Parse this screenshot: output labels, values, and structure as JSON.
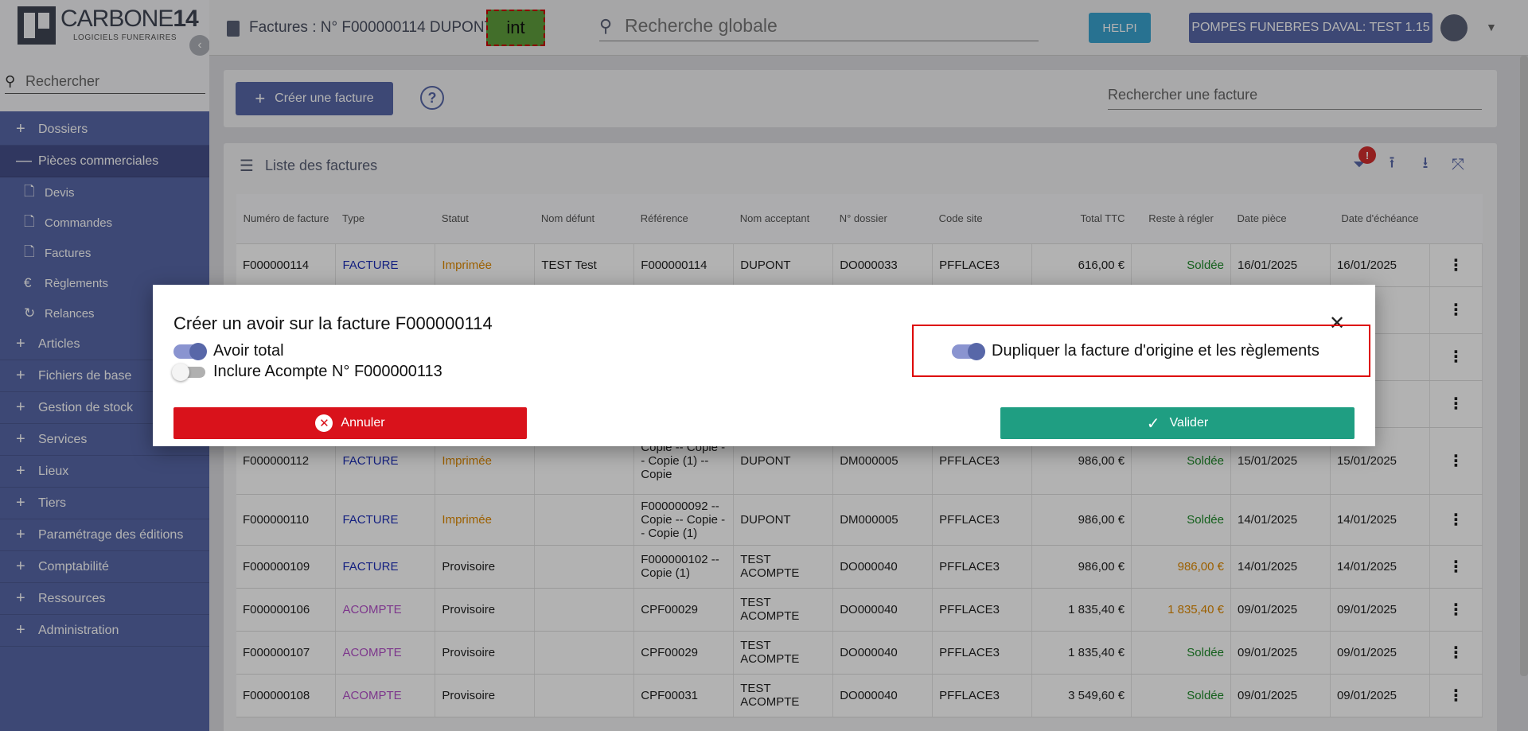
{
  "brand": {
    "name_light": "CARBONE",
    "name_bold": "14",
    "tagline": "LOGICIELS FUNERAIRES"
  },
  "sidebar": {
    "search_placeholder": "Rechercher",
    "items": [
      {
        "label": "Dossiers",
        "expander": "+"
      },
      {
        "label": "Pièces commerciales",
        "expander": "—"
      },
      {
        "label": "Articles",
        "expander": "+"
      },
      {
        "label": "Fichiers de base",
        "expander": "+"
      },
      {
        "label": "Gestion de stock",
        "expander": "+"
      },
      {
        "label": "Services",
        "expander": "+"
      },
      {
        "label": "Lieux",
        "expander": "+"
      },
      {
        "label": "Tiers",
        "expander": "+"
      },
      {
        "label": "Paramétrage des éditions",
        "expander": "+"
      },
      {
        "label": "Comptabilité",
        "expander": "+"
      },
      {
        "label": "Ressources",
        "expander": "+"
      },
      {
        "label": "Administration",
        "expander": "+"
      }
    ],
    "subitems": [
      {
        "label": "Devis",
        "icon": "document-plus-icon"
      },
      {
        "label": "Commandes",
        "icon": "document-upload-icon"
      },
      {
        "label": "Factures",
        "icon": "invoice-icon"
      },
      {
        "label": "Règlements",
        "icon": "euro-icon"
      },
      {
        "label": "Relances",
        "icon": "reminder-icon"
      }
    ]
  },
  "topbar": {
    "title": "Factures : N° F000000114 DUPONT",
    "env_badge": "int",
    "global_search_placeholder": "Recherche globale",
    "helpi_label": "HELPI",
    "agency_label": "POMPES FUNEBRES DAVAL: TEST 1.15"
  },
  "toolbar": {
    "create_label": "Créer une facture",
    "invoice_search_placeholder": "Rechercher une facture"
  },
  "list": {
    "title": "Liste des factures",
    "filter_badge": "!",
    "columns": [
      "Numéro de facture",
      "Type",
      "Statut",
      "Nom défunt",
      "Référence",
      "Nom acceptant",
      "N° dossier",
      "Code site",
      "Total TTC",
      "Reste à régler",
      "Date pièce",
      "Date d'échéance"
    ],
    "rows": [
      {
        "num": "F000000114",
        "type": "FACTURE",
        "statut": "Imprimée",
        "defunt": "TEST Test",
        "ref": "F000000114",
        "acceptant": "DUPONT",
        "dossier": "DO000033",
        "site": "PFFLACE3",
        "total": "616,00 €",
        "reste": "Soldée",
        "date": "16/01/2025",
        "echeance": "16/01/2025"
      },
      {
        "num": "",
        "type": "",
        "statut": "",
        "defunt": "",
        "ref": "",
        "acceptant": "",
        "dossier": "",
        "site": "",
        "total": "",
        "reste": "",
        "date": "",
        "echeance": "/2025"
      },
      {
        "num": "",
        "type": "",
        "statut": "",
        "defunt": "",
        "ref": "",
        "acceptant": "",
        "dossier": "",
        "site": "",
        "total": "",
        "reste": "",
        "date": "",
        "echeance": "/2025"
      },
      {
        "num": "",
        "type": "",
        "statut": "",
        "defunt": "",
        "ref": "",
        "acceptant": "",
        "dossier": "",
        "site": "",
        "total": "",
        "reste": "",
        "date": "",
        "echeance": "/2025"
      },
      {
        "num": "F000000112",
        "type": "FACTURE",
        "statut": "Imprimée",
        "defunt": "",
        "ref": "Copie -- Copie -- Copie (1) -- Copie",
        "acceptant": "DUPONT",
        "dossier": "DM000005",
        "site": "PFFLACE3",
        "total": "986,00 €",
        "reste": "Soldée",
        "date": "15/01/2025",
        "echeance": "15/01/2025"
      },
      {
        "num": "F000000110",
        "type": "FACTURE",
        "statut": "Imprimée",
        "defunt": "",
        "ref": "F000000092 -- Copie -- Copie -- Copie (1)",
        "acceptant": "DUPONT",
        "dossier": "DM000005",
        "site": "PFFLACE3",
        "total": "986,00 €",
        "reste": "Soldée",
        "date": "14/01/2025",
        "echeance": "14/01/2025"
      },
      {
        "num": "F000000109",
        "type": "FACTURE",
        "statut": "Provisoire",
        "defunt": "",
        "ref": "F000000102 -- Copie (1)",
        "acceptant": "TEST ACOMPTE",
        "dossier": "DO000040",
        "site": "PFFLACE3",
        "total": "986,00 €",
        "reste": "986,00 €",
        "date": "14/01/2025",
        "echeance": "14/01/2025"
      },
      {
        "num": "F000000106",
        "type": "ACOMPTE",
        "statut": "Provisoire",
        "defunt": "",
        "ref": "CPF00029",
        "acceptant": "TEST ACOMPTE",
        "dossier": "DO000040",
        "site": "PFFLACE3",
        "total": "1 835,40 €",
        "reste": "1 835,40 €",
        "date": "09/01/2025",
        "echeance": "09/01/2025"
      },
      {
        "num": "F000000107",
        "type": "ACOMPTE",
        "statut": "Provisoire",
        "defunt": "",
        "ref": "CPF00029",
        "acceptant": "TEST ACOMPTE",
        "dossier": "DO000040",
        "site": "PFFLACE3",
        "total": "1 835,40 €",
        "reste": "Soldée",
        "date": "09/01/2025",
        "echeance": "09/01/2025"
      },
      {
        "num": "F000000108",
        "type": "ACOMPTE",
        "statut": "Provisoire",
        "defunt": "",
        "ref": "CPF00031",
        "acceptant": "TEST ACOMPTE",
        "dossier": "DO000040",
        "site": "PFFLACE3",
        "total": "3 549,60 €",
        "reste": "Soldée",
        "date": "09/01/2025",
        "echeance": "09/01/2025"
      }
    ]
  },
  "modal": {
    "title": "Créer un avoir sur la facture F000000114",
    "opt_avoir_total": "Avoir total",
    "opt_inclure_acompte": "Inclure Acompte N° F000000113",
    "opt_dupliquer": "Dupliquer la facture d'origine et les règlements",
    "cancel_label": "Annuler",
    "validate_label": "Valider"
  },
  "colors": {
    "primary": "#5867a8",
    "danger": "#d9121b",
    "success": "#1f9e82",
    "facture": "#1e2fb8",
    "acompte": "#b44fc9"
  }
}
